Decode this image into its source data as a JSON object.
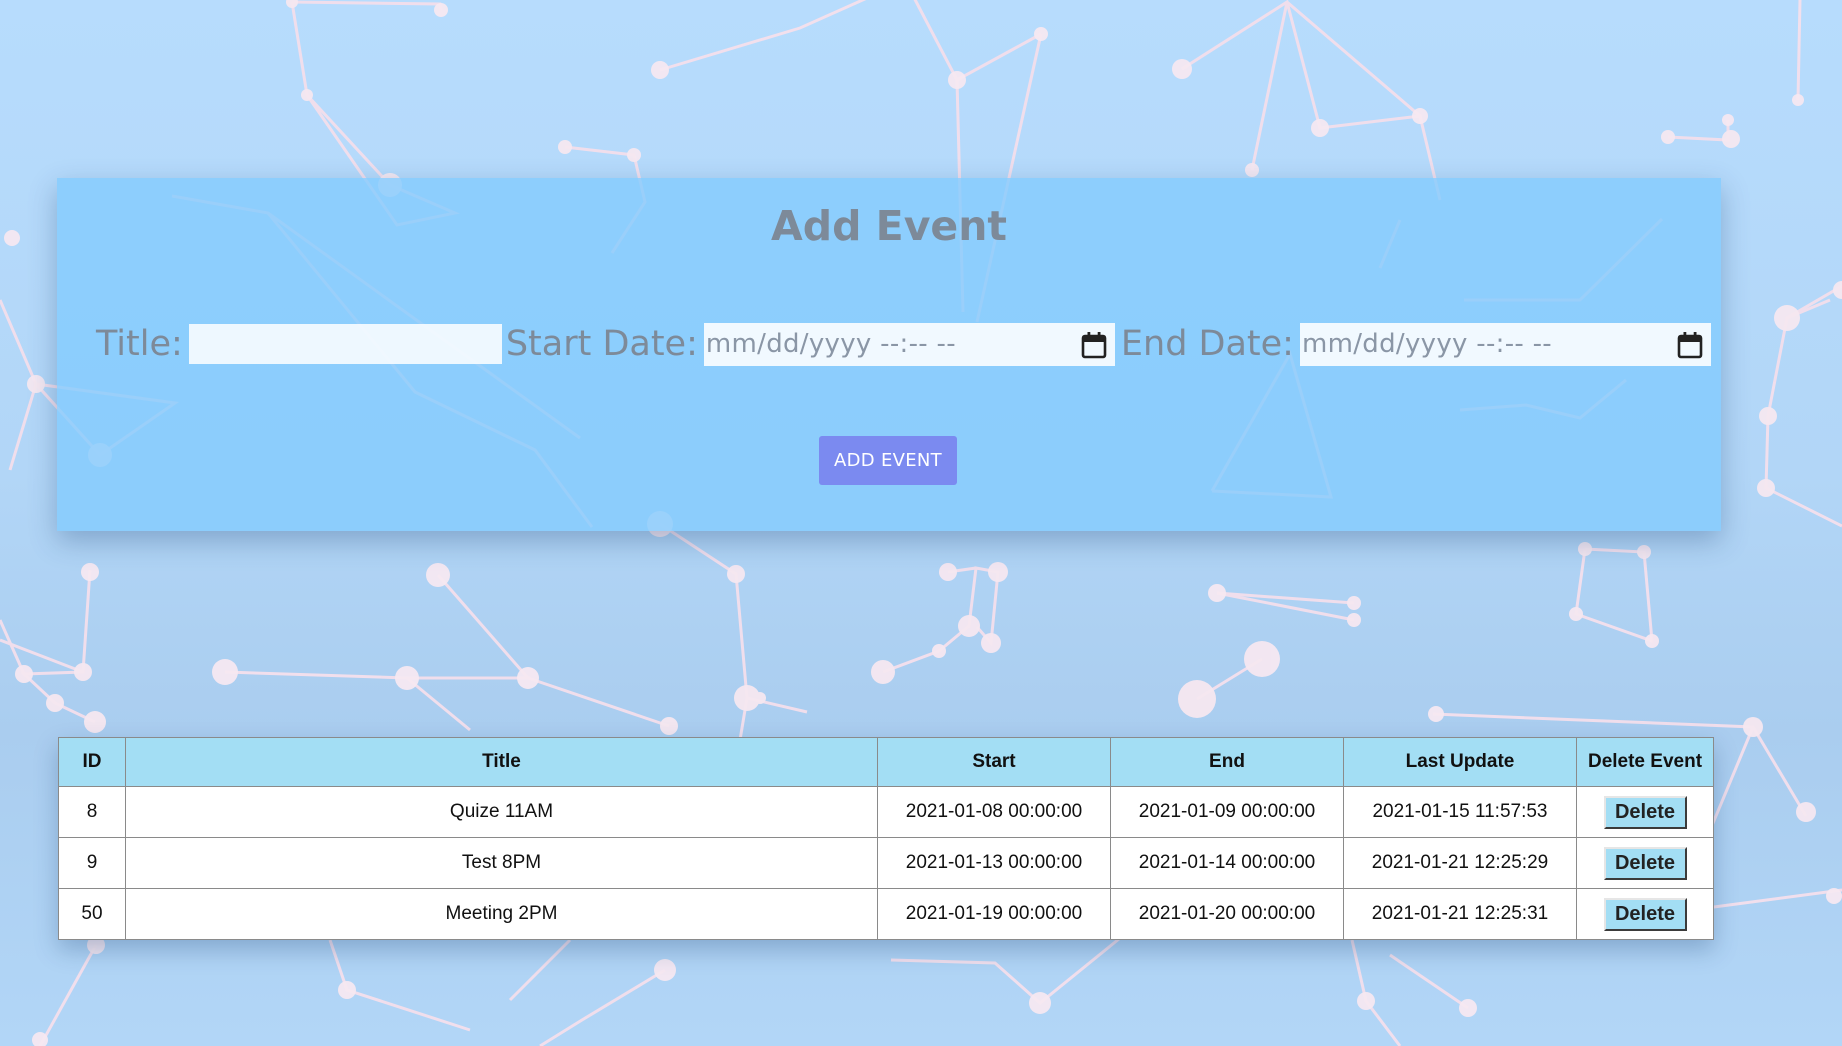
{
  "form": {
    "title": "Add Event",
    "title_label": "Title:",
    "title_value": "",
    "start_label": "Start Date:",
    "start_placeholder": "mm/dd/yyyy --:-- --",
    "end_label": "End Date:",
    "end_placeholder": "mm/dd/yyyy --:-- --",
    "calendar_icon": "calendar-icon",
    "submit_label": "ADD EVENT"
  },
  "table": {
    "headers": {
      "id": "ID",
      "title": "Title",
      "start": "Start",
      "end": "End",
      "last_update": "Last Update",
      "delete": "Delete Event"
    },
    "rows": [
      {
        "id": "8",
        "title": "Quize 11AM",
        "start": "2021-01-08 00:00:00",
        "end": "2021-01-09 00:00:00",
        "last_update": "2021-01-15 11:57:53",
        "delete_label": "Delete"
      },
      {
        "id": "9",
        "title": "Test 8PM",
        "start": "2021-01-13 00:00:00",
        "end": "2021-01-14 00:00:00",
        "last_update": "2021-01-21 12:25:29",
        "delete_label": "Delete"
      },
      {
        "id": "50",
        "title": "Meeting 2PM",
        "start": "2021-01-19 00:00:00",
        "end": "2021-01-20 00:00:00",
        "last_update": "2021-01-21 12:25:31",
        "delete_label": "Delete"
      }
    ]
  },
  "colors": {
    "background": "#b7dcfd",
    "panel": "#82cafe",
    "heading_text": "#7d8a99",
    "button": "#7b8af0",
    "table_header": "#a3def4",
    "network_lines": "#f3dcea"
  }
}
